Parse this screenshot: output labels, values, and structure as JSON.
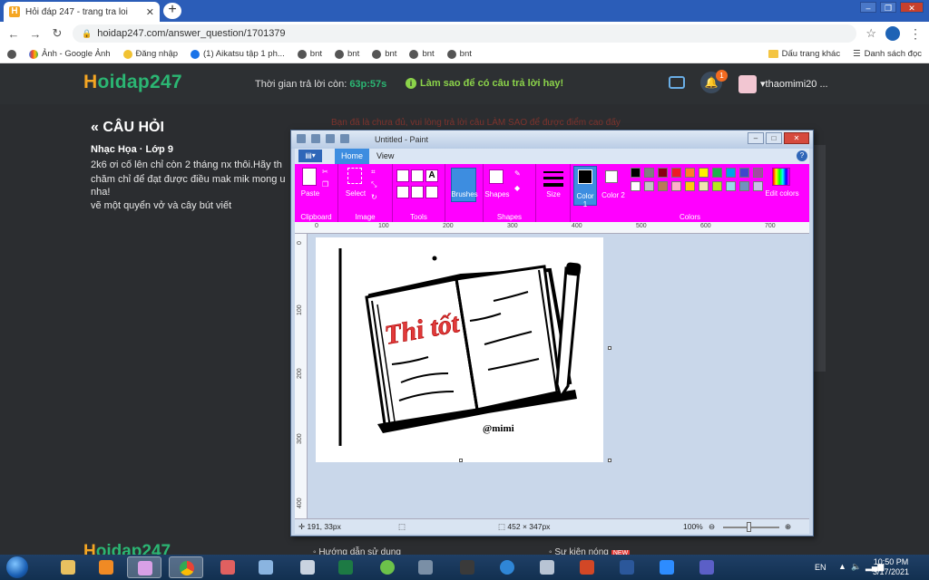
{
  "browser": {
    "tab_title": "Hỏi đáp 247 - trang tra loi",
    "tab_favicon": "H",
    "url": "hoidap247.com/answer_question/1701379",
    "bookmarks": [
      "Ảnh - Google Ảnh",
      "Đăng nhập",
      "(1) Aikatsu tập 1 ph...",
      "bnt",
      "bnt",
      "bnt",
      "bnt",
      "bnt"
    ],
    "bookmarks_right": [
      "Dấu trang khác",
      "Danh sách đọc"
    ]
  },
  "site": {
    "logo_h": "H",
    "logo_rest": "oidap247",
    "timer_label": "Thời gian trả lời còn:",
    "timer_value": "63p:57s",
    "tip": "Làm sao để có câu trả lời hay!",
    "notif_count": "1",
    "username": "thaomimi20 ..."
  },
  "question": {
    "heading": "« CÂU HỎI",
    "subject": "Nhạc Họa · Lớp 9",
    "body": "2k6 ơi cố lên chỉ còn 2 tháng nx thôi.Hãy th chăm chỉ để đạt được điều mak mik mong u",
    "line2": "nha!",
    "line3": "vẽ một quyển vở và cây bút viết",
    "hint": "Bạn đã là chưa đủ, vui lòng trả lời câu LÀM SAO để được điểm cao đấy"
  },
  "footer": {
    "logo_h": "H",
    "logo_rest": "oidap247",
    "link1": "Hướng dẫn sử dụng",
    "link2": "Sự kiện nóng",
    "new_badge": "NEW"
  },
  "paint": {
    "title": "Untitled - Paint",
    "tabs": {
      "home": "Home",
      "view": "View"
    },
    "groups": {
      "clipboard": "Clipboard",
      "image": "Image",
      "tools": "Tools",
      "shapes": "Shapes",
      "colors": "Colors"
    },
    "buttons": {
      "paste": "Paste",
      "select": "Select",
      "brushes": "Brushes",
      "shapes": "Shapes",
      "size": "Size",
      "color1": "Color 1",
      "color2": "Color 2",
      "edit_colors": "Edit colors"
    },
    "ruler_x": [
      "0",
      "100",
      "200",
      "300",
      "400",
      "500",
      "600",
      "700"
    ],
    "ruler_y": [
      "0",
      "100",
      "200",
      "300",
      "400"
    ],
    "palette": [
      "#000000",
      "#7f7f7f",
      "#880015",
      "#ed1c24",
      "#ff7f27",
      "#fff200",
      "#22b14c",
      "#00a2e8",
      "#3f48cc",
      "#a349a4",
      "#ffffff",
      "#c3c3c3",
      "#b97a57",
      "#ffaec9",
      "#ffc90e",
      "#efe4b0",
      "#b5e61d",
      "#99d9ea",
      "#7092be",
      "#c8bfe7"
    ],
    "drawing": {
      "notebook_text": "Thi tốt",
      "signature": "@mimi"
    },
    "status": {
      "cursor_pos": "191, 33px",
      "image_size": "452 × 347px",
      "zoom": "100%"
    }
  },
  "taskbar": {
    "lang": "EN",
    "time": "10:50 PM",
    "date": "3/17/2021"
  }
}
